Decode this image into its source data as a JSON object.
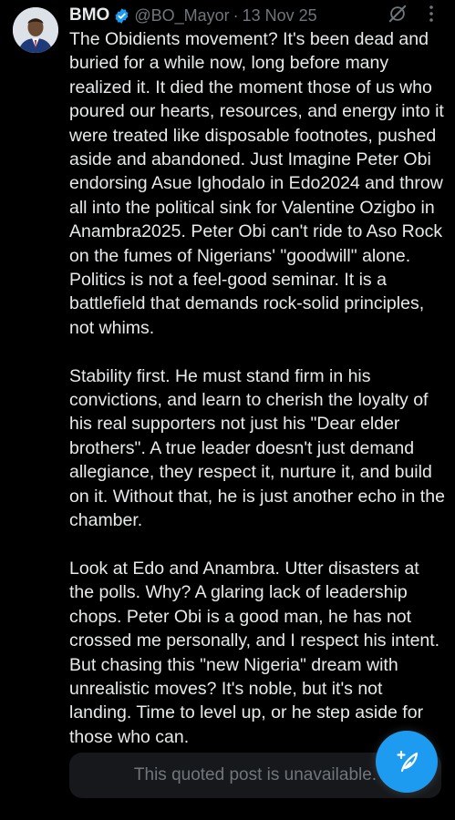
{
  "post": {
    "display_name": "BMO",
    "handle": "@BO_Mayor",
    "separator": "·",
    "date": "13 Nov 25",
    "paragraphs": [
      "The Obidients movement? It's been dead and buried for a while now, long before many realized it. It died the moment those of us who poured our hearts, resources, and energy into it were treated like disposable footnotes, pushed aside and abandoned. Just Imagine Peter Obi endorsing Asue Ighodalo in Edo2024 and throw all into the political sink for Valentine Ozigbo in Anambra2025. Peter Obi can't ride to Aso Rock on the fumes of Nigerians' \"goodwill\" alone. Politics is not a feel-good seminar. It is a battlefield that demands rock-solid principles, not whims.",
      "Stability first. He must stand firm in his convictions, and learn to cherish the loyalty of his real supporters not just his \"Dear elder brothers\". A true leader doesn't just demand allegiance, they respect it, nurture it, and build on it. Without that, he is just another echo in the chamber.",
      "Look at Edo and Anambra. Utter disasters at the polls. Why? A glaring lack of leadership chops. Peter Obi is a good man, he has not crossed me personally, and I respect his intent. But chasing this \"new Nigeria\" dream with unrealistic moves? It's noble, but it's not landing. Time to level up, or he step aside for those who can."
    ],
    "quoted_post_text": "This quoted post is unavailable."
  },
  "icons": {
    "verified": "verified-badge-icon",
    "grok": "grok-icon",
    "more": "more-options-icon",
    "compose": "compose-post-icon"
  },
  "colors": {
    "background": "#000000",
    "text": "#e7e9ea",
    "muted": "#71767b",
    "accent": "#1d9bf0",
    "quote_background": "#16181c"
  }
}
